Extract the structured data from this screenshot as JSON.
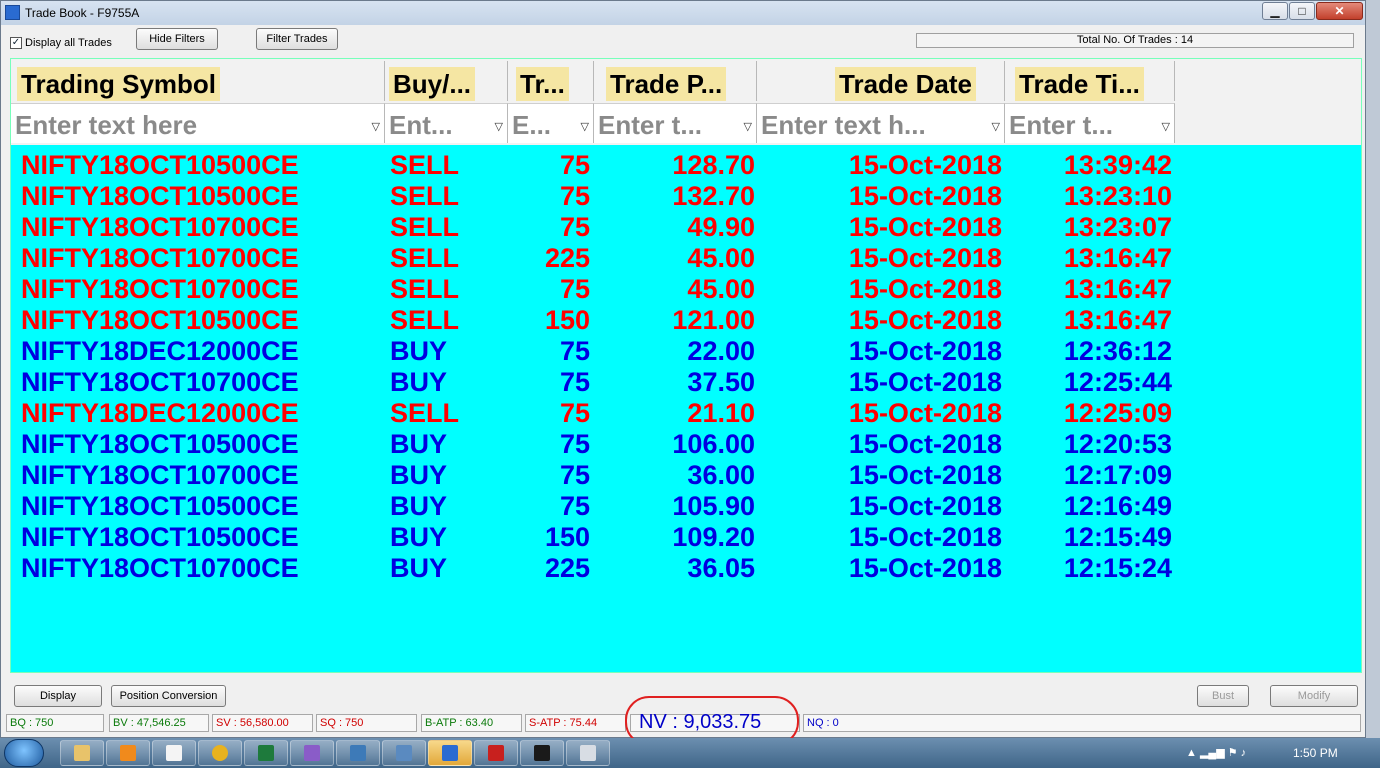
{
  "window": {
    "title": "Trade Book - F9755A"
  },
  "toolbar": {
    "display_all_label": "Display all Trades",
    "display_all_checked": "✓",
    "hide_filters_label": "Hide Filters",
    "filter_trades_label": "Filter Trades",
    "total_label": "Total No. Of Trades : 14"
  },
  "columns": [
    {
      "label": "Trading Symbol",
      "filter_placeholder": "Enter text here"
    },
    {
      "label": "Buy/...",
      "filter_placeholder": "Ent..."
    },
    {
      "label": "Tr...",
      "filter_placeholder": "E..."
    },
    {
      "label": "Trade P...",
      "filter_placeholder": "Enter t..."
    },
    {
      "label": "Trade Date",
      "filter_placeholder": "Enter text h..."
    },
    {
      "label": "Trade Ti...",
      "filter_placeholder": "Enter t..."
    }
  ],
  "trades": [
    {
      "symbol": "NIFTY18OCT10500CE",
      "side": "SELL",
      "qty": "75",
      "price": "128.70",
      "date": "15-Oct-2018",
      "time": "13:39:42"
    },
    {
      "symbol": "NIFTY18OCT10500CE",
      "side": "SELL",
      "qty": "75",
      "price": "132.70",
      "date": "15-Oct-2018",
      "time": "13:23:10"
    },
    {
      "symbol": "NIFTY18OCT10700CE",
      "side": "SELL",
      "qty": "75",
      "price": "49.90",
      "date": "15-Oct-2018",
      "time": "13:23:07"
    },
    {
      "symbol": "NIFTY18OCT10700CE",
      "side": "SELL",
      "qty": "225",
      "price": "45.00",
      "date": "15-Oct-2018",
      "time": "13:16:47"
    },
    {
      "symbol": "NIFTY18OCT10700CE",
      "side": "SELL",
      "qty": "75",
      "price": "45.00",
      "date": "15-Oct-2018",
      "time": "13:16:47"
    },
    {
      "symbol": "NIFTY18OCT10500CE",
      "side": "SELL",
      "qty": "150",
      "price": "121.00",
      "date": "15-Oct-2018",
      "time": "13:16:47"
    },
    {
      "symbol": "NIFTY18DEC12000CE",
      "side": "BUY",
      "qty": "75",
      "price": "22.00",
      "date": "15-Oct-2018",
      "time": "12:36:12"
    },
    {
      "symbol": "NIFTY18OCT10700CE",
      "side": "BUY",
      "qty": "75",
      "price": "37.50",
      "date": "15-Oct-2018",
      "time": "12:25:44"
    },
    {
      "symbol": "NIFTY18DEC12000CE",
      "side": "SELL",
      "qty": "75",
      "price": "21.10",
      "date": "15-Oct-2018",
      "time": "12:25:09"
    },
    {
      "symbol": "NIFTY18OCT10500CE",
      "side": "BUY",
      "qty": "75",
      "price": "106.00",
      "date": "15-Oct-2018",
      "time": "12:20:53"
    },
    {
      "symbol": "NIFTY18OCT10700CE",
      "side": "BUY",
      "qty": "75",
      "price": "36.00",
      "date": "15-Oct-2018",
      "time": "12:17:09"
    },
    {
      "symbol": "NIFTY18OCT10500CE",
      "side": "BUY",
      "qty": "75",
      "price": "105.90",
      "date": "15-Oct-2018",
      "time": "12:16:49"
    },
    {
      "symbol": "NIFTY18OCT10500CE",
      "side": "BUY",
      "qty": "150",
      "price": "109.20",
      "date": "15-Oct-2018",
      "time": "12:15:49"
    },
    {
      "symbol": "NIFTY18OCT10700CE",
      "side": "BUY",
      "qty": "225",
      "price": "36.05",
      "date": "15-Oct-2018",
      "time": "12:15:24"
    }
  ],
  "bottom_buttons": {
    "display": "Display",
    "position_conversion": "Position Conversion",
    "bust": "Bust",
    "modify": "Modify"
  },
  "status": {
    "bq": "BQ : 750",
    "bv": "BV : 47,546.25",
    "sv": "SV : 56,580.00",
    "sq": "SQ : 750",
    "batp": "B-ATP : 63.40",
    "satp": "S-ATP : 75.44",
    "nv": "NV : 9,033.75",
    "nq": "NQ : 0"
  },
  "colors": {
    "sell": "#ff0000",
    "buy": "#0000e0",
    "grid_bg": "#00ffff",
    "header_bg": "#f5e6a3"
  },
  "taskbar": {
    "clock": "1:50 PM"
  }
}
